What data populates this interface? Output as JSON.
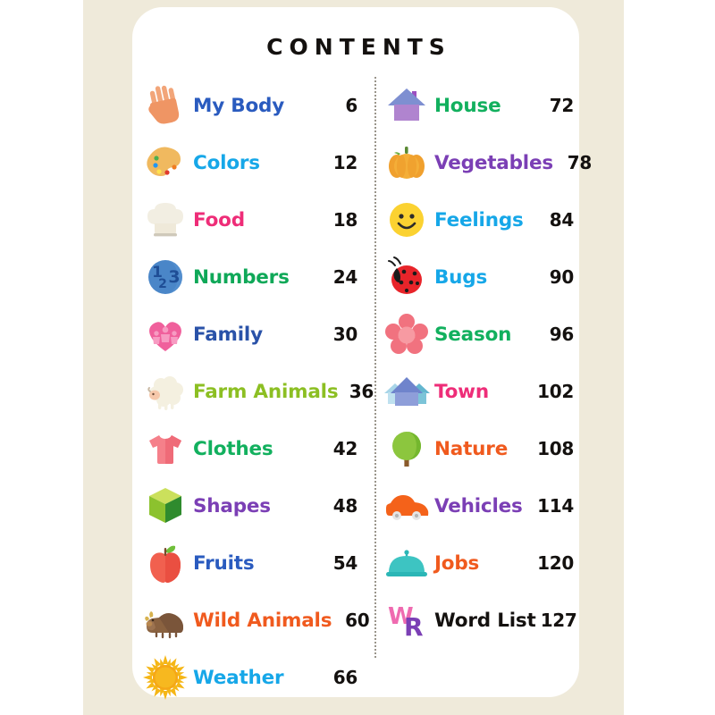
{
  "page": {
    "title": "CONTENTS",
    "background_color": "#ffffff",
    "paper_color": "#efeada",
    "card_color": "#ffffff",
    "page_number_color": "#14110f"
  },
  "columns": {
    "left": [
      {
        "icon": "hand-icon",
        "label": "My Body",
        "page": "6",
        "color": "#2a5bbf"
      },
      {
        "icon": "paint-palette-icon",
        "label": "Colors",
        "page": "12",
        "color": "#16a7e8"
      },
      {
        "icon": "chef-hat-icon",
        "label": "Food",
        "page": "18",
        "color": "#ee2d78"
      },
      {
        "icon": "numbers-123-icon",
        "label": "Numbers",
        "page": "24",
        "color": "#0fa858"
      },
      {
        "icon": "family-heart-icon",
        "label": "Family",
        "page": "30",
        "color": "#2a52a8"
      },
      {
        "icon": "sheep-icon",
        "label": "Farm Animals",
        "page": "36",
        "color": "#8cbf23"
      },
      {
        "icon": "tshirt-icon",
        "label": "Clothes",
        "page": "42",
        "color": "#12b05e"
      },
      {
        "icon": "cube-icon",
        "label": "Shapes",
        "page": "48",
        "color": "#7b3fb5"
      },
      {
        "icon": "apple-icon",
        "label": "Fruits",
        "page": "54",
        "color": "#2a5bbf"
      },
      {
        "icon": "boar-icon",
        "label": "Wild Animals",
        "page": "60",
        "color": "#f05a1e"
      },
      {
        "icon": "sun-icon",
        "label": "Weather",
        "page": "66",
        "color": "#16a7e8"
      }
    ],
    "right": [
      {
        "icon": "house-icon",
        "label": "House",
        "page": "72",
        "color": "#12b05e"
      },
      {
        "icon": "pumpkin-icon",
        "label": "Vegetables",
        "page": "78",
        "color": "#7b3fb5"
      },
      {
        "icon": "smiley-face-icon",
        "label": "Feelings",
        "page": "84",
        "color": "#16a7e8"
      },
      {
        "icon": "ladybug-icon",
        "label": "Bugs",
        "page": "90",
        "color": "#16a7e8"
      },
      {
        "icon": "flower-icon",
        "label": "Season",
        "page": "96",
        "color": "#12b05e"
      },
      {
        "icon": "town-houses-icon",
        "label": "Town",
        "page": "102",
        "color": "#ee2d78"
      },
      {
        "icon": "tree-icon",
        "label": "Nature",
        "page": "108",
        "color": "#f05a1e"
      },
      {
        "icon": "car-icon",
        "label": "Vehicles",
        "page": "114",
        "color": "#7b3fb5"
      },
      {
        "icon": "cloche-icon",
        "label": "Jobs",
        "page": "120",
        "color": "#f05a1e"
      },
      {
        "icon": "wr-logo-icon",
        "label": "Word List",
        "page": "127",
        "color": "#14110f"
      }
    ]
  }
}
